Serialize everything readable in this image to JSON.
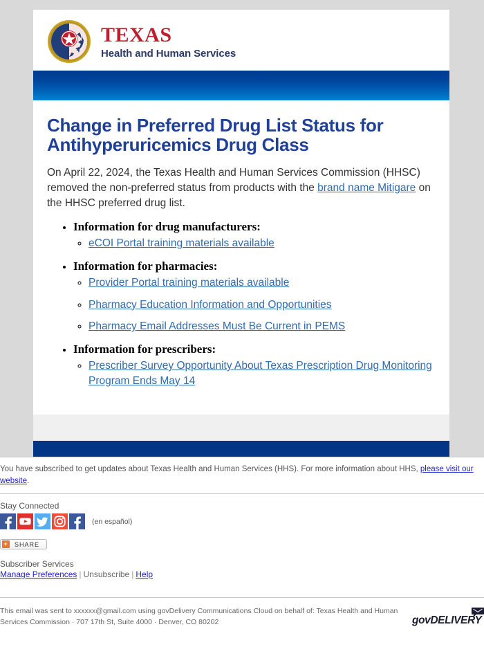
{
  "brand": {
    "seal_name": "texas-state-seal",
    "texas_word": "TEXAS",
    "agency_word": "Health and Human Services",
    "texas_color": "#be1e2d",
    "agency_color": "#2b3a67",
    "banner_gradient_top": "#003a8f",
    "banner_gradient_bottom": "#0083d4",
    "footer_bar_color": "#033587"
  },
  "email": {
    "title": "Change in Preferred Drug List Status for Antihyperuricemics Drug Class",
    "intro_part1": "On April 22, 2024, the Texas Health and Human Services Commission (HHSC) removed the non-preferred status from products with the ",
    "intro_link": "brand name Mitigare",
    "intro_part2": " on the HHSC preferred drug list.",
    "title_color": "#1f4096",
    "link_color": "#2f6cb0",
    "sections": [
      {
        "heading": "Information for drug manufacturers:",
        "links": [
          "eCOI Portal training materials available"
        ]
      },
      {
        "heading": "Information for pharmacies:",
        "links": [
          "Provider Portal training materials available",
          "Pharmacy Education Information and Opportunities",
          "Pharmacy Email Addresses Must Be Current in PEMS"
        ]
      },
      {
        "heading": "Information for prescribers:",
        "links": [
          "Prescriber Survey Opportunity About Texas Prescription Drug Monitoring Program Ends May 14"
        ]
      }
    ]
  },
  "footer": {
    "subscription_text_before": "You have subscribed to get updates about Texas Health and Human Services (HHS). For more information about HHS, ",
    "subscription_link": "please visit our website",
    "subscription_text_after": ".",
    "stay_connected_label": "Stay Connected",
    "social": [
      {
        "name": "facebook-icon",
        "color": "#3b5998"
      },
      {
        "name": "youtube-icon",
        "color": "#e02f2f"
      },
      {
        "name": "twitter-icon",
        "color": "#55acee"
      },
      {
        "name": "instagram-icon",
        "color": "#f04a38"
      },
      {
        "name": "facebook-espanol-icon",
        "color": "#3b5998"
      }
    ],
    "espanol_label": "(en español)",
    "share_button_label": "SHARE",
    "share_icon_color": "#e8762c",
    "subscriber_services_label": "Subscriber Services",
    "manage_preferences_label": "Manage Preferences",
    "unsubscribe_label": "Unsubscribe",
    "help_label": "Help",
    "separator": "|",
    "sent_text_line1": "This email was sent to xxxxxx@gmail.com using govDelivery Communications Cloud on behalf of: Texas Health and Human",
    "sent_text_line2": "Services Commission · 707 17th St, Suite 4000 · Denver, CO 80202",
    "govdelivery_label": "govDELIVERY"
  }
}
